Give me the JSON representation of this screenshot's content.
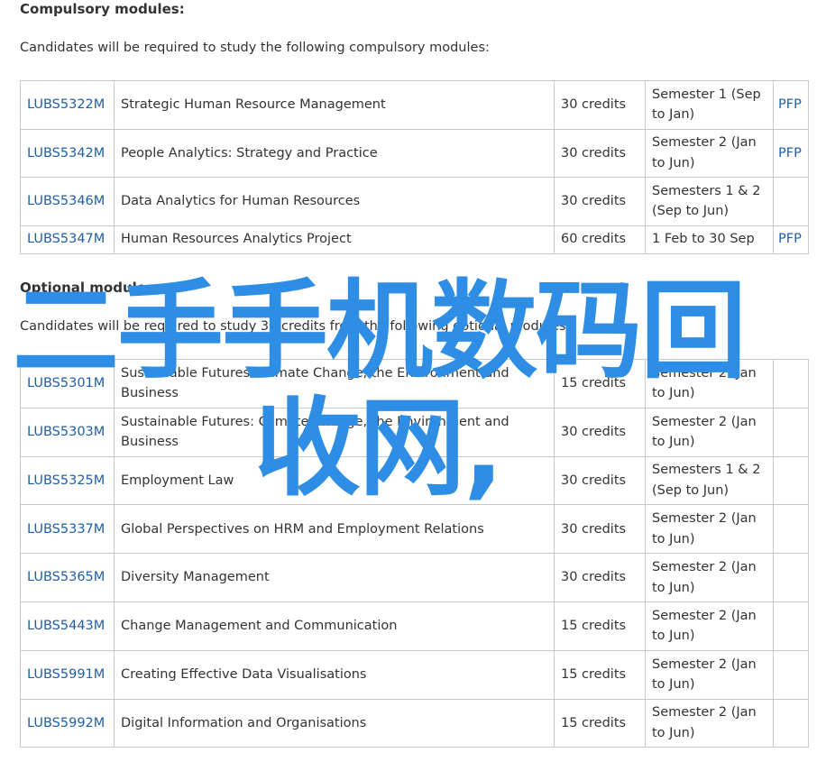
{
  "compulsory": {
    "heading": "Compulsory modules:",
    "intro": "Candidates will be required to study the following compulsory modules:",
    "rows": [
      {
        "code": "LUBS5322M",
        "title": "Strategic Human Resource Management",
        "credits": "30 credits",
        "semester": "Semester 1 (Sep to Jan)",
        "pfp": "PFP"
      },
      {
        "code": "LUBS5342M",
        "title": "People Analytics: Strategy and Practice",
        "credits": "30 credits",
        "semester": "Semester 2 (Jan to Jun)",
        "pfp": "PFP"
      },
      {
        "code": "LUBS5346M",
        "title": "Data Analytics for Human Resources",
        "credits": "30 credits",
        "semester": "Semesters 1 & 2 (Sep to Jun)",
        "pfp": ""
      },
      {
        "code": "LUBS5347M",
        "title": "Human Resources Analytics Project",
        "credits": "60 credits",
        "semester": "1 Feb to 30 Sep",
        "pfp": "PFP"
      }
    ]
  },
  "optional": {
    "heading": "Optional modules:",
    "intro": "Candidates will be required to study 30 credits from the following optional modules:",
    "rows": [
      {
        "code": "LUBS5301M",
        "title": "Sustainable Futures: Climate Change, the Environment and Business",
        "credits": "15 credits",
        "semester": "Semester 2 (Jan to Jun)",
        "pfp": ""
      },
      {
        "code": "LUBS5303M",
        "title": "Sustainable Futures: Climate Change, the Environment and Business",
        "credits": "30 credits",
        "semester": "Semester 2 (Jan to Jun)",
        "pfp": ""
      },
      {
        "code": "LUBS5325M",
        "title": "Employment Law",
        "credits": "30 credits",
        "semester": "Semesters 1 & 2 (Sep to Jun)",
        "pfp": ""
      },
      {
        "code": "LUBS5337M",
        "title": "Global Perspectives on HRM and Employment Relations",
        "credits": "30 credits",
        "semester": "Semester 2 (Jan to Jun)",
        "pfp": ""
      },
      {
        "code": "LUBS5365M",
        "title": "Diversity Management",
        "credits": "30 credits",
        "semester": "Semester 2 (Jan to Jun)",
        "pfp": ""
      },
      {
        "code": "LUBS5443M",
        "title": "Change Management and Communication",
        "credits": "15 credits",
        "semester": "Semester 2 (Jan to Jun)",
        "pfp": ""
      },
      {
        "code": "LUBS5991M",
        "title": "Creating Effective Data Visualisations",
        "credits": "15 credits",
        "semester": "Semester 2 (Jan to Jun)",
        "pfp": ""
      },
      {
        "code": "LUBS5992M",
        "title": "Digital Information and Organisations",
        "credits": "15 credits",
        "semester": "Semester 2 (Jan to Jun)",
        "pfp": ""
      }
    ]
  },
  "watermark": {
    "line1": "二手手机数码回",
    "line2": "收网,",
    "color": "#2e8de5"
  },
  "colors": {
    "link": "#1f5fa8",
    "text": "#333333",
    "border": "#c8c8c8"
  }
}
